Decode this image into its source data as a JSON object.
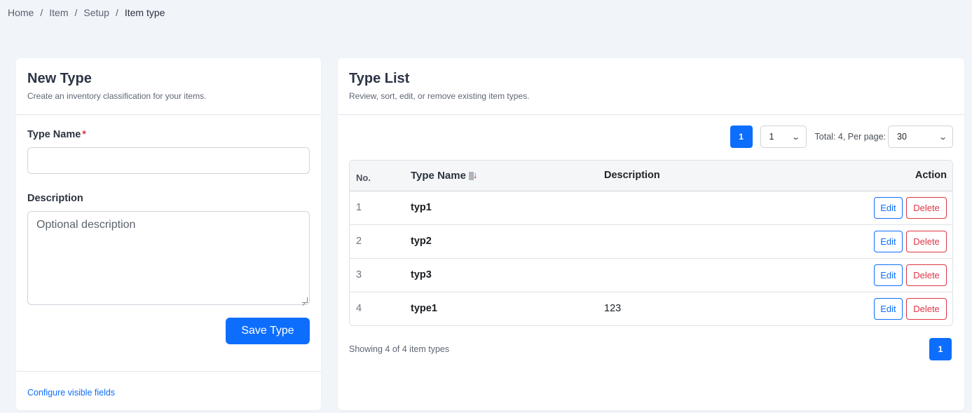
{
  "breadcrumb": {
    "items": [
      "Home",
      "Item",
      "Setup"
    ],
    "current": "Item type",
    "separator": "/"
  },
  "new_type": {
    "title": "New Type",
    "subtitle": "Create an inventory classification for your items.",
    "type_name_label": "Type Name",
    "required_mark": "*",
    "type_name_value": "",
    "description_label": "Description",
    "description_placeholder": "Optional description",
    "save_button": "Save Type",
    "configure_link": "Configure visible fields"
  },
  "type_list": {
    "title": "Type List",
    "subtitle": "Review, sort, edit, or remove existing item types.",
    "current_page": "1",
    "page_select_value": "1",
    "total_text": "Total: 4, Per page:",
    "per_page_value": "30",
    "columns": {
      "no": "No.",
      "type_name": "Type Name",
      "description": "Description",
      "action": "Action"
    },
    "sort_icon": "sort-descending-icon",
    "rows": [
      {
        "no": "1",
        "type_name": "typ1",
        "description": "",
        "edit": "Edit",
        "delete": "Delete"
      },
      {
        "no": "2",
        "type_name": "typ2",
        "description": "",
        "edit": "Edit",
        "delete": "Delete"
      },
      {
        "no": "3",
        "type_name": "typ3",
        "description": "",
        "edit": "Edit",
        "delete": "Delete"
      },
      {
        "no": "4",
        "type_name": "type1",
        "description": "123",
        "edit": "Edit",
        "delete": "Delete"
      }
    ],
    "showing_text": "Showing 4 of 4 item types",
    "bottom_page": "1"
  },
  "colors": {
    "primary": "#0d6efd",
    "danger": "#dc3545",
    "page_bg": "#f1f4f9"
  }
}
